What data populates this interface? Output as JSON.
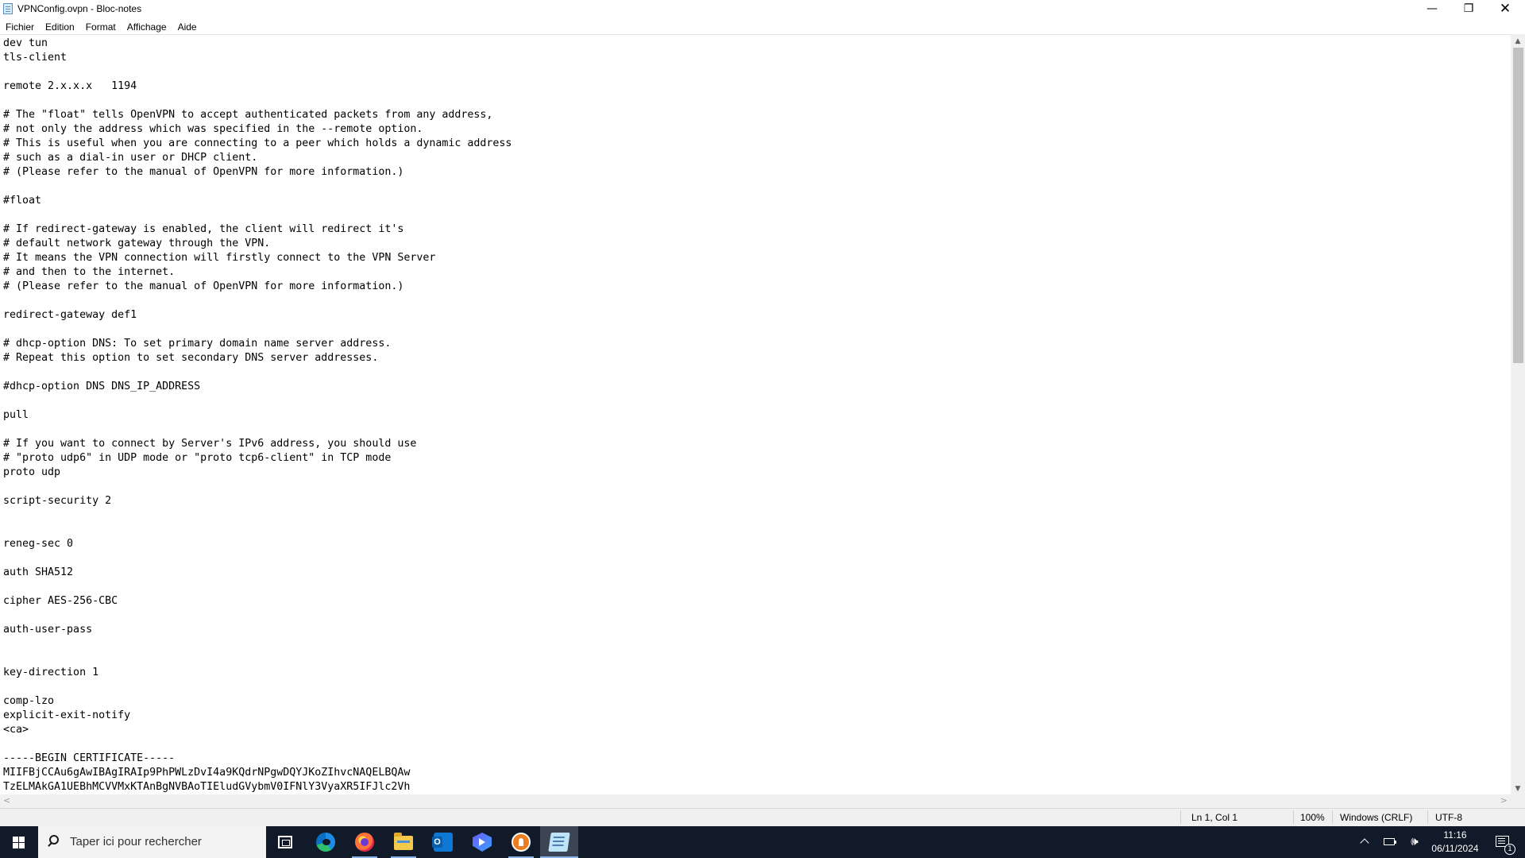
{
  "window": {
    "title": "VPNConfig.ovpn - Bloc-notes",
    "minimize_glyph": "—",
    "maximize_glyph": "❐",
    "close_glyph": "✕"
  },
  "menu": {
    "items": [
      {
        "label": "Fichier"
      },
      {
        "label": "Edition"
      },
      {
        "label": "Format"
      },
      {
        "label": "Affichage"
      },
      {
        "label": "Aide"
      }
    ]
  },
  "editor": {
    "text": "dev tun\ntls-client\n\nremote 2.x.x.x   1194\n\n# The \"float\" tells OpenVPN to accept authenticated packets from any address,\n# not only the address which was specified in the --remote option.\n# This is useful when you are connecting to a peer which holds a dynamic address\n# such as a dial-in user or DHCP client.\n# (Please refer to the manual of OpenVPN for more information.)\n\n#float\n\n# If redirect-gateway is enabled, the client will redirect it's\n# default network gateway through the VPN.\n# It means the VPN connection will firstly connect to the VPN Server\n# and then to the internet.\n# (Please refer to the manual of OpenVPN for more information.)\n\nredirect-gateway def1\n\n# dhcp-option DNS: To set primary domain name server address.\n# Repeat this option to set secondary DNS server addresses.\n\n#dhcp-option DNS DNS_IP_ADDRESS\n\npull\n\n# If you want to connect by Server's IPv6 address, you should use\n# \"proto udp6\" in UDP mode or \"proto tcp6-client\" in TCP mode\nproto udp\n\nscript-security 2\n\n\nreneg-sec 0\n\nauth SHA512\n\ncipher AES-256-CBC\n\nauth-user-pass\n\n\nkey-direction 1\n\ncomp-lzo\nexplicit-exit-notify\n<ca>\n\n-----BEGIN CERTIFICATE-----\nMIIFBjCCAu6gAwIBAgIRAIp9PhPWLzDvI4a9KQdrNPgwDQYJKoZIhvcNAQELBQAw\nTzELMAkGA1UEBhMCVVMxKTAnBgNVBAoTIEludGVybmV0IFNlY3VyaXR5IFJlc2Vh"
  },
  "scrollbar": {
    "up": "▲",
    "down": "▼",
    "left": "<",
    "right": ">"
  },
  "statusbar": {
    "position": "Ln 1, Col 1",
    "zoom": "100%",
    "line_ending": "Windows (CRLF)",
    "encoding": "UTF-8"
  },
  "taskbar": {
    "search_placeholder": "Taper ici pour rechercher",
    "apps": [
      {
        "icon": "task-view-icon"
      },
      {
        "icon": "edge-icon"
      },
      {
        "icon": "firefox-icon"
      },
      {
        "icon": "file-explorer-icon"
      },
      {
        "icon": "outlook-icon"
      },
      {
        "icon": "vpn-shield-icon"
      },
      {
        "icon": "openvpn-icon"
      },
      {
        "icon": "notepad-icon"
      }
    ],
    "tray": {
      "volume_glyph": "🕪",
      "time": "11:16",
      "date": "06/11/2024",
      "notification_count": "1"
    }
  }
}
